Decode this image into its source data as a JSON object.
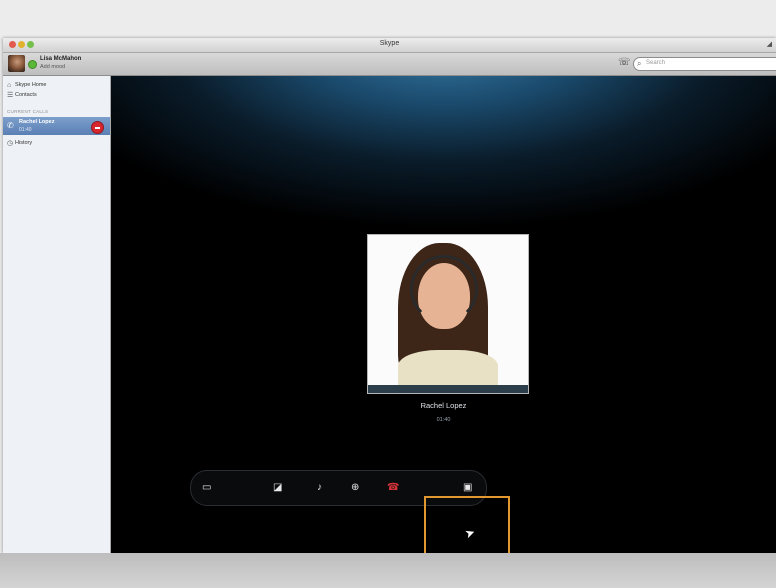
{
  "window": {
    "title": "Skype"
  },
  "toolbar": {
    "user_name": "Lisa McMahon",
    "user_mood": "Add mood",
    "search_placeholder": "Search"
  },
  "sidebar": {
    "items": [
      {
        "label": "Skype Home",
        "icon": "home-icon"
      },
      {
        "label": "Contacts",
        "icon": "contacts-icon"
      }
    ],
    "section_header": "CURRENT CALLS",
    "active_call": {
      "name": "Rachel Lopez",
      "status": "01:40"
    },
    "history": {
      "label": "History",
      "icon": "clock-icon"
    }
  },
  "call": {
    "caller_name": "Rachel Lopez",
    "duration": "01:40"
  },
  "controls": {
    "icons": [
      "video-icon",
      "video-off-icon",
      "mute-icon",
      "add-icon",
      "hangup-icon",
      "chat-icon"
    ]
  },
  "colors": {
    "accent": "#e3982f",
    "hangup": "#d6343a",
    "online": "#5cb83a",
    "sidebar_selection": "#5a7fb4"
  }
}
